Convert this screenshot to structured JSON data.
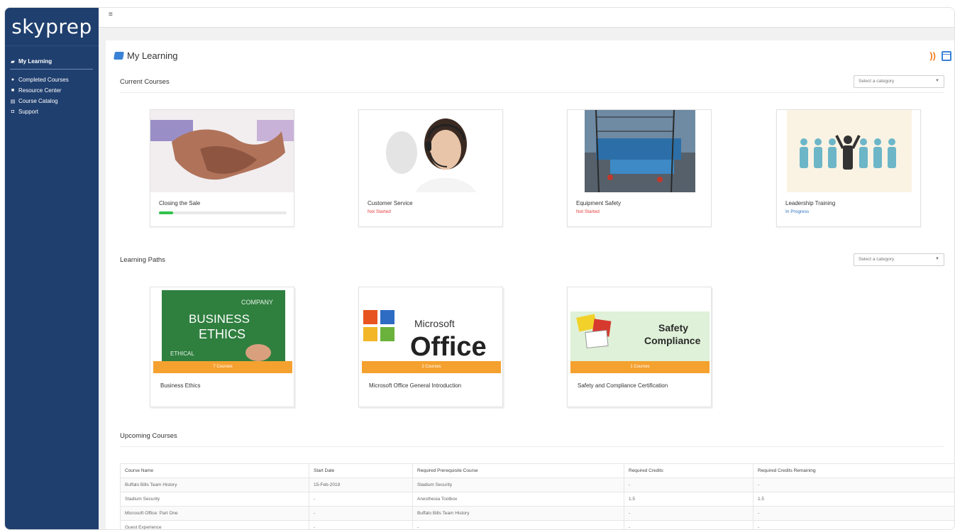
{
  "brand": {
    "logo": "skyprep"
  },
  "sidebar": {
    "items": [
      {
        "label": "My Learning"
      },
      {
        "label": "Completed Courses"
      },
      {
        "label": "Resource Center"
      },
      {
        "label": "Course Catalog"
      },
      {
        "label": "Support"
      }
    ]
  },
  "topbar": {
    "menu_icon": "≡"
  },
  "page": {
    "title": "My Learning"
  },
  "current": {
    "title": "Current Courses",
    "select_placeholder": "Select a category",
    "courses": [
      {
        "name": "Closing the Sale",
        "status": "",
        "progress": 0.11
      },
      {
        "name": "Customer Service",
        "status": "Not Started"
      },
      {
        "name": "Equipment Safety",
        "status": "Not Started"
      },
      {
        "name": "Leadership Training",
        "status": "In Progress"
      }
    ]
  },
  "paths": {
    "title": "Learning Paths",
    "select_placeholder": "Select a category",
    "items": [
      {
        "name": "Business Ethics",
        "count": "7 Courses",
        "thumb_lines": [
          "COMPANY",
          "BUSINESS",
          "ETHICS",
          "ETHICAL"
        ]
      },
      {
        "name": "Microsoft Office General Introduction",
        "count": "2 Courses",
        "thumb_lines": [
          "Microsoft",
          "Office"
        ]
      },
      {
        "name": "Safety and Compliance Certification",
        "count": "1 Courses",
        "thumb_lines": [
          "Safety",
          "Compliance"
        ]
      }
    ]
  },
  "upcoming": {
    "title": "Upcoming Courses",
    "headers": [
      "Course Name",
      "Start Date",
      "Required Prerequisite Course",
      "Required Credits",
      "Required Credits Remaining"
    ],
    "rows": [
      [
        "Buffalo Bills Team History",
        "15-Feb-2019",
        "Stadium Security",
        "-",
        "-"
      ],
      [
        "Stadium Security",
        "-",
        "Anesthesia Toolbox",
        "1.5",
        "1.5"
      ],
      [
        "Microsoft Office: Part One",
        "-",
        "Buffalo Bills Team History",
        "-",
        "-"
      ],
      [
        "Guest Experience",
        "-",
        "-",
        "-",
        "-"
      ]
    ]
  },
  "colors": {
    "sidebar": "#1f3f6e",
    "accent_orange": "#f5a12f",
    "progress_green": "#31c24d",
    "status_red": "#e23b3b",
    "status_blue": "#2f72c4"
  },
  "icons": [
    "book-icon",
    "rss-icon",
    "calendar-icon",
    "hamburger-icon"
  ]
}
